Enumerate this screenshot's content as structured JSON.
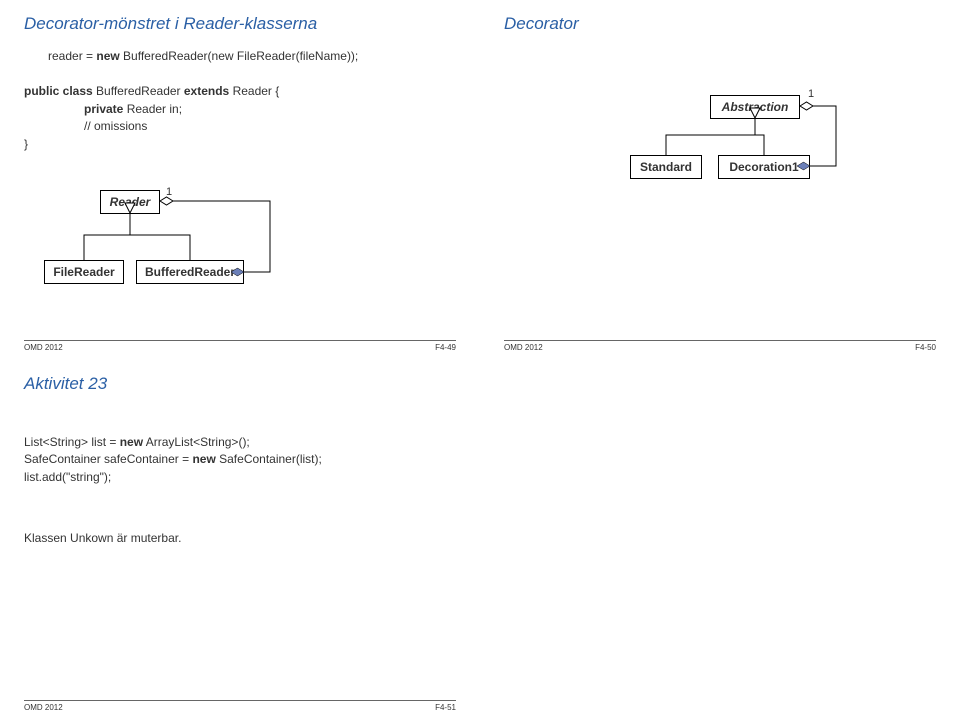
{
  "q1": {
    "title": "Decorator-mönstret i Reader-klasserna",
    "code_line1_pre": "reader = ",
    "code_line1_kw": "new",
    "code_line1_post": " BufferedReader(new FileReader(fileName));",
    "classdecl_pre": "public class ",
    "classdecl_mid": "BufferedReader ",
    "classdecl_post": "extends",
    "classdecl_tail": " Reader {",
    "field_pre": "private ",
    "field_mid": "Reader in;",
    "omissions": "// omissions",
    "close": "}",
    "multiplicity": "1",
    "box_reader": "Reader",
    "box_filereader": "FileReader",
    "box_bufferedreader": "BufferedReader",
    "footer_left": "OMD 2012",
    "footer_right": "F4-49"
  },
  "q2": {
    "title": "Decorator",
    "multiplicity": "1",
    "box_abstraction": "Abstraction",
    "box_standard": "Standard",
    "box_decoration": "Decoration1",
    "footer_left": "OMD 2012",
    "footer_right": "F4-50"
  },
  "q3": {
    "title": "Aktivitet 23",
    "line1_pre": "List<String> list = ",
    "line1_kw": "new",
    "line1_post": " ArrayList<String>();",
    "line2_pre": "SafeContainer safeContainer = ",
    "line2_kw": "new",
    "line2_post": " SafeContainer(list);",
    "line3": "list.add(\"string\");",
    "note": "Klassen Unkown är muterbar.",
    "footer_left": "OMD 2012",
    "footer_right": "F4-51"
  }
}
